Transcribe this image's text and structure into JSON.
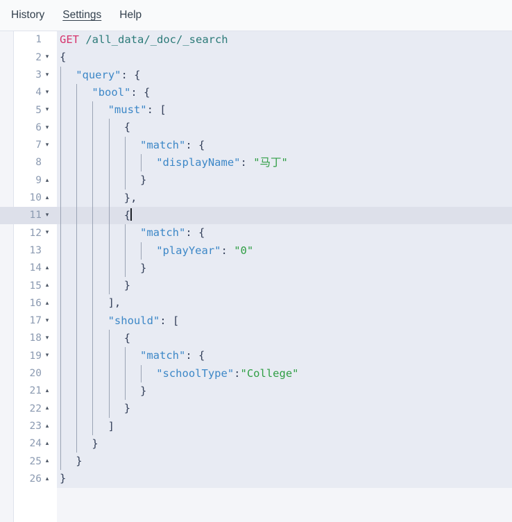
{
  "menubar": {
    "items": [
      {
        "label": "History",
        "state": "normal"
      },
      {
        "label": "Settings",
        "state": "hovered"
      },
      {
        "label": "Help",
        "state": "normal"
      }
    ]
  },
  "editor": {
    "active_line": 11,
    "cursor_line": 11,
    "cursor_column": 8,
    "total_lines": 26,
    "colors": {
      "background": "#e8ebf3",
      "gutter_background": "#ffffff",
      "active_line": "#dde0ea",
      "line_number": "#8b9ab1",
      "method": "#d6336c",
      "url": "#2b7a78",
      "key": "#3c87c7",
      "string": "#2f9e44",
      "punctuation": "#34405a",
      "indent_guide": "#9aa3b4"
    },
    "fold_open_glyph": "▾",
    "fold_close_glyph": "▴",
    "lines": [
      {
        "n": 1,
        "fold": "none",
        "indent": 0,
        "guides": 0,
        "tokens": [
          {
            "t": "GET",
            "c": "method"
          },
          {
            "t": " ",
            "c": "punct"
          },
          {
            "t": "/all_data/_doc/_search",
            "c": "url"
          }
        ]
      },
      {
        "n": 2,
        "fold": "open",
        "indent": 0,
        "guides": 0,
        "tokens": [
          {
            "t": "{",
            "c": "punct"
          }
        ]
      },
      {
        "n": 3,
        "fold": "open",
        "indent": 1,
        "guides": 1,
        "tokens": [
          {
            "t": "\"query\"",
            "c": "key"
          },
          {
            "t": ": {",
            "c": "punct"
          }
        ]
      },
      {
        "n": 4,
        "fold": "open",
        "indent": 2,
        "guides": 2,
        "tokens": [
          {
            "t": "\"bool\"",
            "c": "key"
          },
          {
            "t": ": {",
            "c": "punct"
          }
        ]
      },
      {
        "n": 5,
        "fold": "open",
        "indent": 3,
        "guides": 3,
        "tokens": [
          {
            "t": "\"must\"",
            "c": "key"
          },
          {
            "t": ": [",
            "c": "punct"
          }
        ]
      },
      {
        "n": 6,
        "fold": "open",
        "indent": 4,
        "guides": 4,
        "tokens": [
          {
            "t": "{",
            "c": "punct"
          }
        ]
      },
      {
        "n": 7,
        "fold": "open",
        "indent": 5,
        "guides": 5,
        "tokens": [
          {
            "t": "\"match\"",
            "c": "key"
          },
          {
            "t": ": {",
            "c": "punct"
          }
        ]
      },
      {
        "n": 8,
        "fold": "none",
        "indent": 6,
        "guides": 6,
        "tokens": [
          {
            "t": "\"displayName\"",
            "c": "key"
          },
          {
            "t": ": ",
            "c": "punct"
          },
          {
            "t": "\"马丁\"",
            "c": "str"
          }
        ]
      },
      {
        "n": 9,
        "fold": "close",
        "indent": 5,
        "guides": 5,
        "tokens": [
          {
            "t": "}",
            "c": "punct"
          }
        ]
      },
      {
        "n": 10,
        "fold": "close",
        "indent": 4,
        "guides": 4,
        "tokens": [
          {
            "t": "},",
            "c": "punct"
          }
        ]
      },
      {
        "n": 11,
        "fold": "open",
        "indent": 4,
        "guides": 4,
        "tokens": [
          {
            "t": "{",
            "c": "punct"
          }
        ],
        "cursor_after": true
      },
      {
        "n": 12,
        "fold": "open",
        "indent": 5,
        "guides": 5,
        "tokens": [
          {
            "t": "\"match\"",
            "c": "key"
          },
          {
            "t": ": {",
            "c": "punct"
          }
        ]
      },
      {
        "n": 13,
        "fold": "none",
        "indent": 6,
        "guides": 6,
        "tokens": [
          {
            "t": "\"playYear\"",
            "c": "key"
          },
          {
            "t": ": ",
            "c": "punct"
          },
          {
            "t": "\"0\"",
            "c": "str"
          }
        ]
      },
      {
        "n": 14,
        "fold": "close",
        "indent": 5,
        "guides": 5,
        "tokens": [
          {
            "t": "}",
            "c": "punct"
          }
        ]
      },
      {
        "n": 15,
        "fold": "close",
        "indent": 4,
        "guides": 4,
        "tokens": [
          {
            "t": "}",
            "c": "punct"
          }
        ]
      },
      {
        "n": 16,
        "fold": "close",
        "indent": 3,
        "guides": 3,
        "tokens": [
          {
            "t": "],",
            "c": "punct"
          }
        ]
      },
      {
        "n": 17,
        "fold": "open",
        "indent": 3,
        "guides": 3,
        "tokens": [
          {
            "t": "\"should\"",
            "c": "key"
          },
          {
            "t": ": [",
            "c": "punct"
          }
        ]
      },
      {
        "n": 18,
        "fold": "open",
        "indent": 4,
        "guides": 4,
        "tokens": [
          {
            "t": "{",
            "c": "punct"
          }
        ]
      },
      {
        "n": 19,
        "fold": "open",
        "indent": 5,
        "guides": 5,
        "tokens": [
          {
            "t": "\"match\"",
            "c": "key"
          },
          {
            "t": ": {",
            "c": "punct"
          }
        ]
      },
      {
        "n": 20,
        "fold": "none",
        "indent": 6,
        "guides": 6,
        "tokens": [
          {
            "t": "\"schoolType\"",
            "c": "key"
          },
          {
            "t": ":",
            "c": "punct"
          },
          {
            "t": "\"College\"",
            "c": "str"
          }
        ]
      },
      {
        "n": 21,
        "fold": "close",
        "indent": 5,
        "guides": 5,
        "tokens": [
          {
            "t": "}",
            "c": "punct"
          }
        ]
      },
      {
        "n": 22,
        "fold": "close",
        "indent": 4,
        "guides": 4,
        "tokens": [
          {
            "t": "}",
            "c": "punct"
          }
        ]
      },
      {
        "n": 23,
        "fold": "close",
        "indent": 3,
        "guides": 3,
        "tokens": [
          {
            "t": "]",
            "c": "punct"
          }
        ]
      },
      {
        "n": 24,
        "fold": "close",
        "indent": 2,
        "guides": 2,
        "tokens": [
          {
            "t": "}",
            "c": "punct"
          }
        ]
      },
      {
        "n": 25,
        "fold": "close",
        "indent": 1,
        "guides": 1,
        "tokens": [
          {
            "t": "}",
            "c": "punct"
          }
        ]
      },
      {
        "n": 26,
        "fold": "close",
        "indent": 0,
        "guides": 0,
        "tokens": [
          {
            "t": "}",
            "c": "punct"
          }
        ]
      }
    ]
  }
}
